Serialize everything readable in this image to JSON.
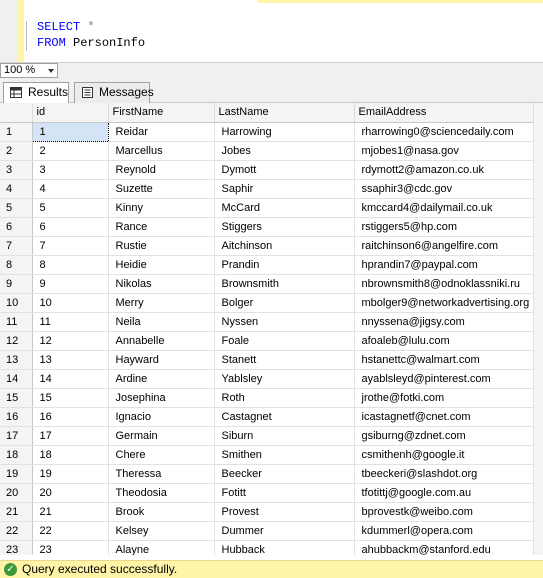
{
  "editor": {
    "line1": {
      "keyword": "SELECT",
      "rest": "*"
    },
    "line2": {
      "keyword": "FROM",
      "rest": "PersonInfo"
    }
  },
  "zoom": {
    "value": "100 %"
  },
  "tabs": [
    {
      "label": "Results",
      "icon": "grid-icon",
      "active": true
    },
    {
      "label": "Messages",
      "icon": "messages-icon",
      "active": false
    }
  ],
  "grid": {
    "columns": [
      "id",
      "FirstName",
      "LastName",
      "EmailAddress"
    ],
    "rows": [
      [
        "1",
        "1",
        "Reidar",
        "Harrowing",
        "rharrowing0@sciencedaily.com"
      ],
      [
        "2",
        "2",
        "Marcellus",
        "Jobes",
        "mjobes1@nasa.gov"
      ],
      [
        "3",
        "3",
        "Reynold",
        "Dymott",
        "rdymott2@amazon.co.uk"
      ],
      [
        "4",
        "4",
        "Suzette",
        "Saphir",
        "ssaphir3@cdc.gov"
      ],
      [
        "5",
        "5",
        "Kinny",
        "McCard",
        "kmccard4@dailymail.co.uk"
      ],
      [
        "6",
        "6",
        "Rance",
        "Stiggers",
        "rstiggers5@hp.com"
      ],
      [
        "7",
        "7",
        "Rustie",
        "Aitchinson",
        "raitchinson6@angelfire.com"
      ],
      [
        "8",
        "8",
        "Heidie",
        "Prandin",
        "hprandin7@paypal.com"
      ],
      [
        "9",
        "9",
        "Nikolas",
        "Brownsmith",
        "nbrownsmith8@odnoklassniki.ru"
      ],
      [
        "10",
        "10",
        "Merry",
        "Bolger",
        "mbolger9@networkadvertising.org"
      ],
      [
        "11",
        "11",
        "Neila",
        "Nyssen",
        "nnyssena@jigsy.com"
      ],
      [
        "12",
        "12",
        "Annabelle",
        "Foale",
        "afoaleb@lulu.com"
      ],
      [
        "13",
        "13",
        "Hayward",
        "Stanett",
        "hstanettc@walmart.com"
      ],
      [
        "14",
        "14",
        "Ardine",
        "Yablsley",
        "ayablsleyd@pinterest.com"
      ],
      [
        "15",
        "15",
        "Josephina",
        "Roth",
        "jrothe@fotki.com"
      ],
      [
        "16",
        "16",
        "Ignacio",
        "Castagnet",
        "icastagnetf@cnet.com"
      ],
      [
        "17",
        "17",
        "Germain",
        "Siburn",
        "gsiburng@zdnet.com"
      ],
      [
        "18",
        "18",
        "Chere",
        "Smithen",
        "csmithenh@google.it"
      ],
      [
        "19",
        "19",
        "Theressa",
        "Beecker",
        "tbeeckeri@slashdot.org"
      ],
      [
        "20",
        "20",
        "Theodosia",
        "Fotitt",
        "tfotittj@google.com.au"
      ],
      [
        "21",
        "21",
        "Brook",
        "Provest",
        "bprovestk@weibo.com"
      ],
      [
        "22",
        "22",
        "Kelsey",
        "Dummer",
        "kdummerl@opera.com"
      ],
      [
        "23",
        "23",
        "Alayne",
        "Hubback",
        "ahubbackm@stanford.edu"
      ]
    ]
  },
  "status": {
    "icon": "check-circle-icon",
    "text": "Query executed successfully."
  }
}
